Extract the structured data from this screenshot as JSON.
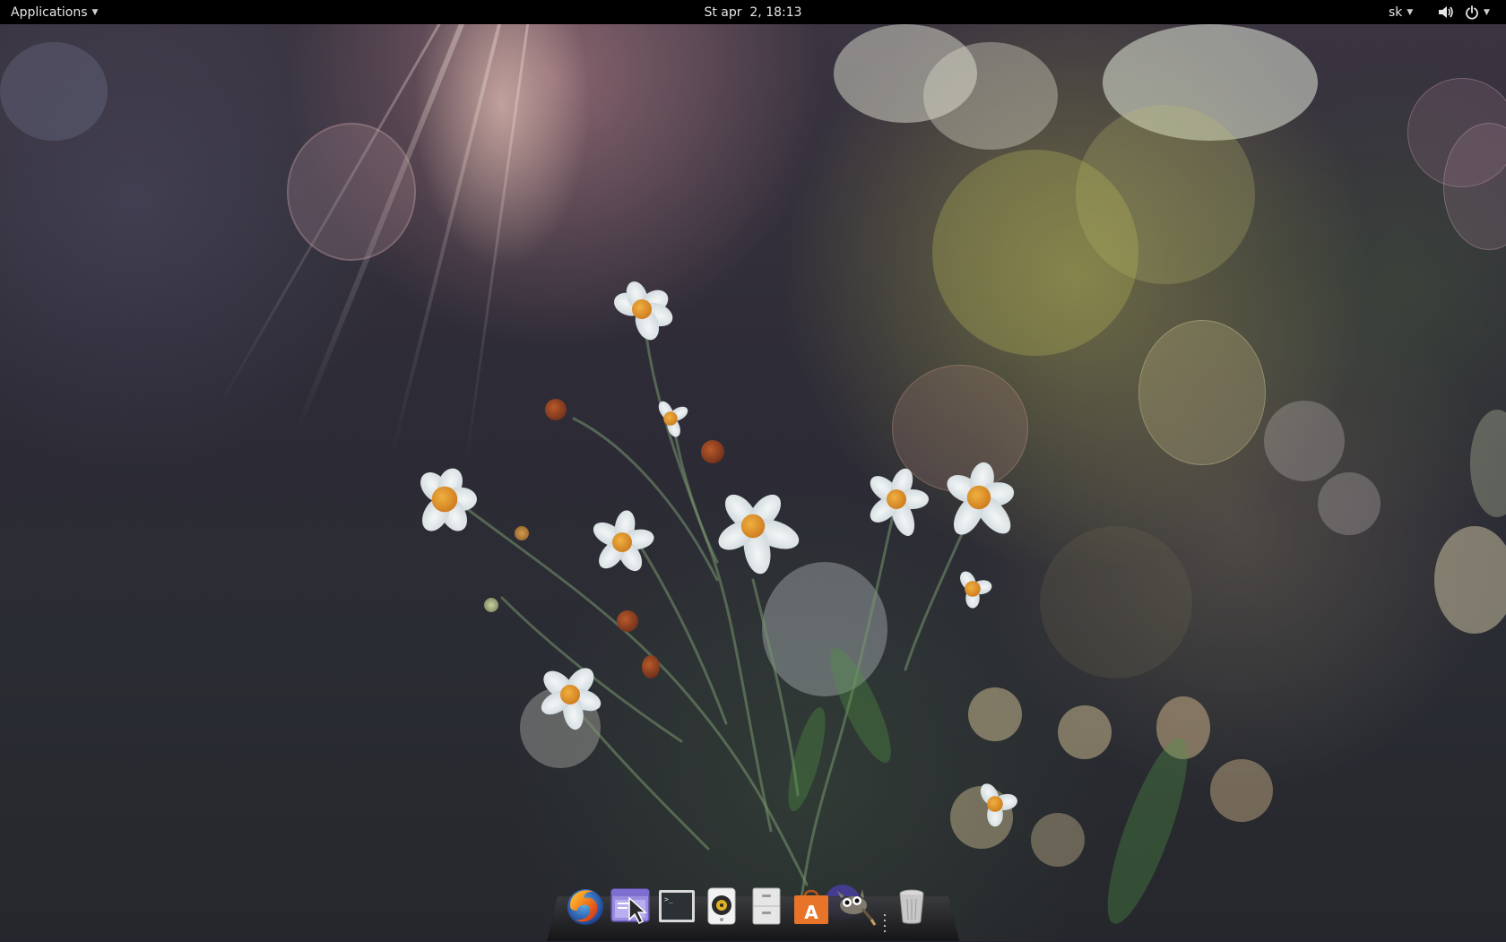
{
  "top_panel": {
    "applications_label": "Applications",
    "clock": "St apr  2, 18:13",
    "keyboard_layout": "sk",
    "volume_icon": "speaker-icon",
    "power_icon": "power-icon"
  },
  "dock": {
    "items": [
      {
        "name": "firefox",
        "icon": "firefox-icon"
      },
      {
        "name": "screenshot",
        "icon": "cursor-window-icon"
      },
      {
        "name": "terminal",
        "icon": "terminal-icon"
      },
      {
        "name": "music",
        "icon": "speaker-player-icon"
      },
      {
        "name": "files",
        "icon": "file-cabinet-icon"
      },
      {
        "name": "software-center",
        "icon": "shopping-bag-icon"
      },
      {
        "name": "gimp",
        "icon": "gimp-icon"
      },
      {
        "name": "trash",
        "icon": "trash-icon"
      }
    ]
  },
  "colors": {
    "panel_bg": "#000000",
    "panel_text": "#e6e6e6",
    "software_center_orange": "#e8742a"
  }
}
